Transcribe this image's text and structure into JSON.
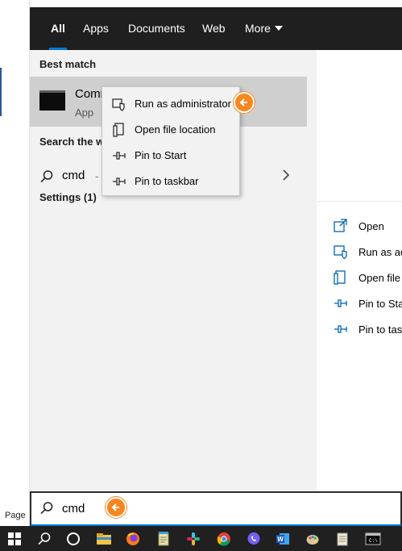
{
  "tabs": [
    {
      "label": "All",
      "active": true
    },
    {
      "label": "Apps"
    },
    {
      "label": "Documents"
    },
    {
      "label": "Web"
    },
    {
      "label": "More"
    }
  ],
  "best_match": {
    "section_label": "Best match",
    "title": "Comm",
    "subtitle": "App"
  },
  "search_web": {
    "section_label": "Search the we",
    "query": "cmd",
    "suffix": "- Se"
  },
  "settings": {
    "section_label": "Settings (1)"
  },
  "context_menu": {
    "items": [
      {
        "label": "Run as administrator",
        "icon": "shield-icon"
      },
      {
        "label": "Open file location",
        "icon": "file-icon"
      },
      {
        "label": "Pin to Start",
        "icon": "pin-icon"
      },
      {
        "label": "Pin to taskbar",
        "icon": "pin-icon"
      }
    ]
  },
  "right_actions": [
    {
      "label": "Open",
      "icon": "open-icon"
    },
    {
      "label": "Run as ac",
      "icon": "shield-icon"
    },
    {
      "label": "Open file",
      "icon": "file-icon"
    },
    {
      "label": "Pin to Sta",
      "icon": "pin-icon"
    },
    {
      "label": "Pin to tas",
      "icon": "pin-icon"
    }
  ],
  "search_box": {
    "value": "cmd"
  },
  "background_doc": {
    "label": "Page"
  },
  "taskbar": {
    "items": [
      "windows-start-icon",
      "search-icon",
      "cortana-icon",
      "file-explorer-icon",
      "firefox-icon",
      "notepad-icon",
      "slack-icon",
      "chrome-icon",
      "viber-icon",
      "word-icon",
      "paint-icon",
      "notes-icon",
      "command-prompt-icon"
    ]
  },
  "colors": {
    "accent": "#0078d7",
    "callout": "#f7861f",
    "tabbar": "#1f1f1f",
    "taskbar": "#202020"
  }
}
